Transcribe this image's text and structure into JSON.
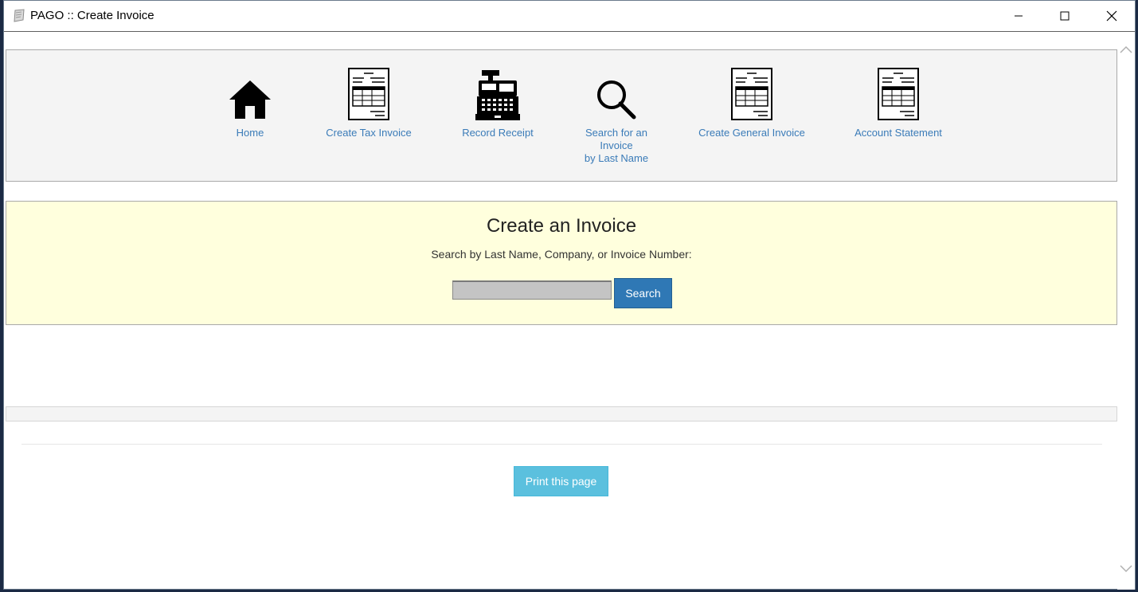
{
  "window": {
    "title": "PAGO :: Create Invoice"
  },
  "nav": {
    "items": [
      {
        "label": "Home",
        "icon": "home-icon"
      },
      {
        "label": "Create Tax Invoice",
        "icon": "invoice-document-icon"
      },
      {
        "label": "Record Receipt",
        "icon": "cash-register-icon"
      },
      {
        "label": "Search for an\nInvoice\nby Last Name",
        "icon": "magnifier-icon"
      },
      {
        "label": "Create General Invoice",
        "icon": "invoice-document-icon"
      },
      {
        "label": "Account Statement",
        "icon": "invoice-document-icon"
      }
    ]
  },
  "search": {
    "heading": "Create an Invoice",
    "hint": "Search by Last Name, Company, or Invoice Number:",
    "input_value": "",
    "button_label": "Search"
  },
  "footer": {
    "print_label": "Print this page"
  },
  "colors": {
    "link": "#3a7bb8",
    "search_panel_bg": "#ffffdd",
    "primary_button": "#2f78b5",
    "info_button": "#5bc0de"
  }
}
